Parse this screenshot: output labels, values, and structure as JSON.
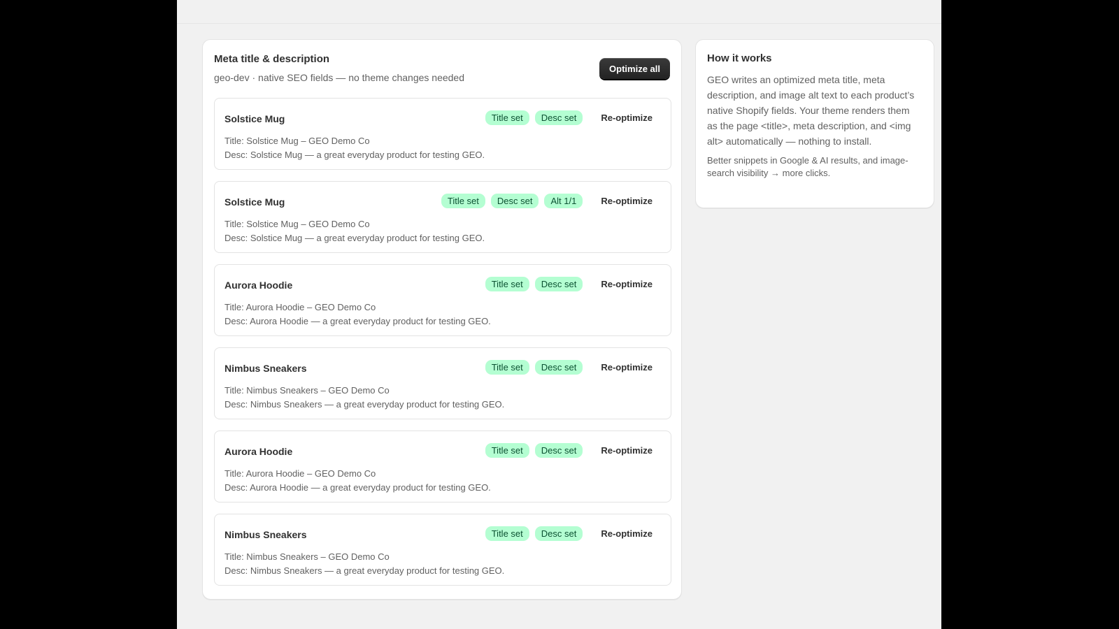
{
  "main": {
    "title": "Meta title & description",
    "subtitle": "geo-dev · native SEO fields — no theme changes needed",
    "optimize_all_label": "Optimize all",
    "reoptimize_label": "Re-optimize",
    "products": [
      {
        "name": "Solstice Mug",
        "badges": [
          "Title set",
          "Desc set"
        ],
        "title_line": "Title: Solstice Mug – GEO Demo Co",
        "desc_line": "Desc: Solstice Mug — a great everyday product for testing GEO."
      },
      {
        "name": "Solstice Mug",
        "badges": [
          "Title set",
          "Desc set",
          "Alt 1/1"
        ],
        "title_line": "Title: Solstice Mug – GEO Demo Co",
        "desc_line": "Desc: Solstice Mug — a great everyday product for testing GEO."
      },
      {
        "name": "Aurora Hoodie",
        "badges": [
          "Title set",
          "Desc set"
        ],
        "title_line": "Title: Aurora Hoodie – GEO Demo Co",
        "desc_line": "Desc: Aurora Hoodie — a great everyday product for testing GEO."
      },
      {
        "name": "Nimbus Sneakers",
        "badges": [
          "Title set",
          "Desc set"
        ],
        "title_line": "Title: Nimbus Sneakers – GEO Demo Co",
        "desc_line": "Desc: Nimbus Sneakers — a great everyday product for testing GEO."
      },
      {
        "name": "Aurora Hoodie",
        "badges": [
          "Title set",
          "Desc set"
        ],
        "title_line": "Title: Aurora Hoodie – GEO Demo Co",
        "desc_line": "Desc: Aurora Hoodie — a great everyday product for testing GEO."
      },
      {
        "name": "Nimbus Sneakers",
        "badges": [
          "Title set",
          "Desc set"
        ],
        "title_line": "Title: Nimbus Sneakers – GEO Demo Co",
        "desc_line": "Desc: Nimbus Sneakers — a great everyday product for testing GEO."
      }
    ]
  },
  "sidebar": {
    "title": "How it works",
    "body": "GEO writes an optimized meta title, meta description, and image alt text to each product’s native Shopify fields. Your theme renders them as the page <title>, meta description, and <img alt> automatically — nothing to install.",
    "note": "Better snippets in Google & AI results, and image-search visibility → more clicks."
  },
  "colors": {
    "badge_bg": "#b4fed2",
    "badge_text": "#0c5132",
    "primary_button": "#303030",
    "page_bg": "#f1f1f1"
  }
}
